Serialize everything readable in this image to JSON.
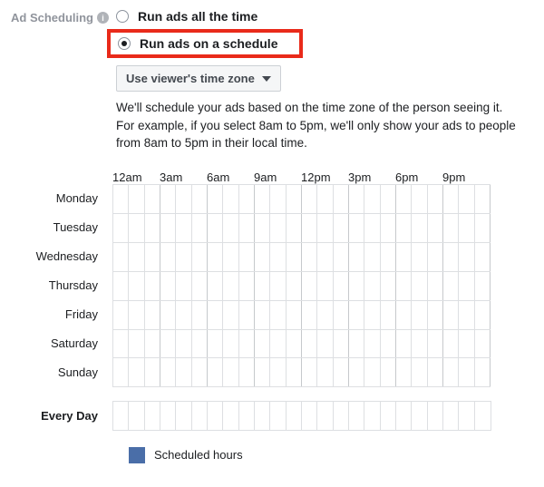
{
  "section_label": "Ad Scheduling",
  "radios": {
    "all_time": "Run ads all the time",
    "schedule": "Run ads on a schedule"
  },
  "timezone_dropdown": {
    "selected": "Use viewer's time zone"
  },
  "help_text_1": "We'll schedule your ads based on the time zone of the person seeing it.",
  "help_text_2": "For example, if you select 8am to 5pm, we'll only show your ads to people from 8am to 5pm in their local time.",
  "time_headers": [
    "12am",
    "3am",
    "6am",
    "9am",
    "12pm",
    "3pm",
    "6pm",
    "9pm"
  ],
  "days": [
    "Monday",
    "Tuesday",
    "Wednesday",
    "Thursday",
    "Friday",
    "Saturday",
    "Sunday"
  ],
  "every_day_label": "Every Day",
  "legend_label": "Scheduled hours"
}
